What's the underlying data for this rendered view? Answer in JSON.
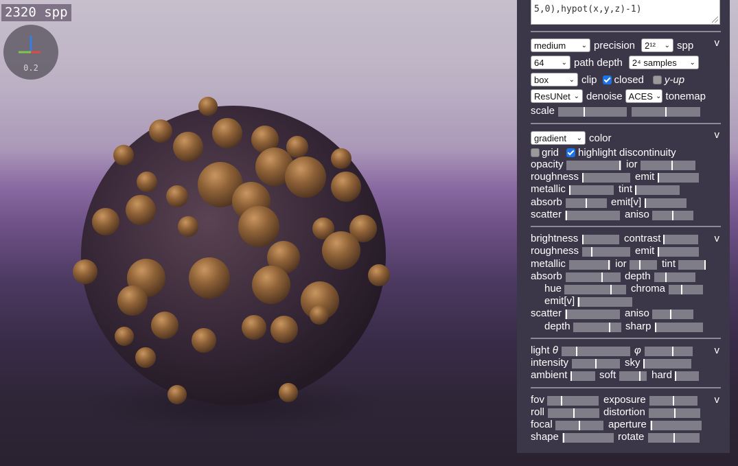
{
  "hud": {
    "spp_counter": "2320 spp",
    "axes_scale": "0.2"
  },
  "editor": {
    "code_text": "5,0),hypot(x,y,z)-1)"
  },
  "render_section": {
    "toggle": "v",
    "precision_value": "medium",
    "precision_label": "precision",
    "spp_value": "2¹²",
    "spp_label": "spp",
    "path_depth_value": "64",
    "path_depth_label": "path depth",
    "samples_value": "2⁴ samples",
    "clip_value": "box",
    "clip_label": "clip",
    "closed_label": "closed",
    "closed_checked": true,
    "yup_label": "y-up",
    "yup_checked": false,
    "denoise_value": "ResUNet",
    "denoise_label": "denoise",
    "tonemap_value": "ACES",
    "tonemap_label": "tonemap",
    "scale_label": "scale",
    "scale_a": 0.38,
    "scale_b": 0.5
  },
  "color_section": {
    "toggle": "v",
    "color_mode_value": "gradient",
    "color_label": "color",
    "grid_label": "grid",
    "grid_checked": false,
    "highlight_label": "highlight discontinuity",
    "highlight_checked": true,
    "opacity_label": "opacity",
    "opacity": 0.98,
    "ior_label": "ior",
    "ior": 0.58,
    "roughness_label": "roughness",
    "roughness": 0.02,
    "emit_label": "emit",
    "emit": 0.02,
    "metallic_label": "metallic",
    "metallic": 0.02,
    "tint_label": "tint",
    "tint": 0.02,
    "absorb_label": "absorb",
    "absorb": 0.5,
    "emitv_label": "emit[v]",
    "emitv": 0.02,
    "scatter_label": "scatter",
    "scatter": 0.02,
    "aniso_label": "aniso",
    "aniso": 0.5
  },
  "material_section": {
    "toggle": "v",
    "brightness_label": "brightness",
    "brightness": 0.02,
    "contrast_label": "contrast",
    "contrast": 0.02,
    "roughness_label": "roughness",
    "roughness": 0.2,
    "emit_label": "emit",
    "emit": 0.02,
    "metallic_label": "metallic",
    "metallic": 0.97,
    "ior_label": "ior",
    "ior": 0.38,
    "tint_label": "tint",
    "tint": 0.97,
    "absorb_label": "absorb",
    "absorb": 0.66,
    "depth_label": "depth",
    "depth": 0.28,
    "hue_label": "hue",
    "hue": 0.75,
    "chroma_label": "chroma",
    "chroma": 0.38,
    "emitv_label": "emit[v]",
    "emitv": 0.02,
    "scatter_label": "scatter",
    "scatter": 0.02,
    "aniso_label": "aniso",
    "aniso": 0.45,
    "depth2_label": "depth",
    "depth2": 0.75,
    "sharp_label": "sharp",
    "sharp": 0.02
  },
  "light_section": {
    "toggle": "v",
    "light_label": "light",
    "theta_symbol": "θ",
    "theta": 0.22,
    "phi_symbol": "φ",
    "phi": 0.58,
    "intensity_label": "intensity",
    "intensity": 0.5,
    "sky_label": "sky",
    "sky": 0.02,
    "ambient_label": "ambient",
    "ambient": 0.02,
    "soft_label": "soft",
    "soft": 0.75,
    "hard_label": "hard",
    "hard": 0.02
  },
  "camera_section": {
    "toggle": "v",
    "fov_label": "fov",
    "fov": 0.28,
    "exposure_label": "exposure",
    "exposure": 0.5,
    "roll_label": "roll",
    "roll": 0.5,
    "distortion_label": "distortion",
    "distortion": 0.5,
    "focal_label": "focal",
    "focal": 0.5,
    "aperture_label": "aperture",
    "aperture": 0.02,
    "shape_label": "shape",
    "shape": 0.02,
    "rotate_label": "rotate",
    "rotate": 0.5
  },
  "colors": {
    "panel_bg": "#3b3748",
    "slider_track": "#7f7d87",
    "checkbox_on": "#1a73e8",
    "blob_main": "#3d2c3b",
    "blob_bump": "#8a5e34"
  }
}
